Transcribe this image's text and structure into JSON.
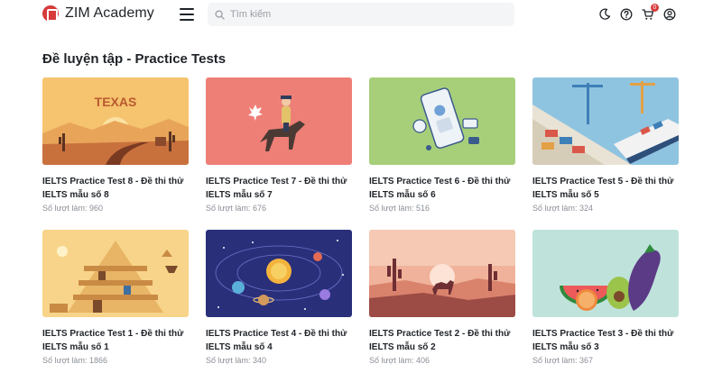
{
  "header": {
    "brand": "ZIM Academy",
    "search_placeholder": "Tìm kiếm",
    "cart_count": "0"
  },
  "main": {
    "title": "Đề luyện tập - Practice Tests",
    "count_label": "Số lượt làm:",
    "tests": [
      {
        "title": "IELTS Practice Test 8 - Đề thi thử IELTS mẫu số 8",
        "count": "960",
        "art": "texas",
        "art_text": "TEXAS"
      },
      {
        "title": "IELTS Practice Test 7 - Đề thi thử IELTS mẫu số 7",
        "count": "676",
        "art": "rider"
      },
      {
        "title": "IELTS Practice Test 6 - Đề thi thử IELTS mẫu số 6",
        "count": "516",
        "art": "phone"
      },
      {
        "title": "IELTS Practice Test 5 - Đề thi thử IELTS mẫu số 5",
        "count": "324",
        "art": "port"
      },
      {
        "title": "IELTS Practice Test 1 - Đề thi thử IELTS mẫu số 1",
        "count": "1866",
        "art": "egypt"
      },
      {
        "title": "IELTS Practice Test 4 - Đề thi thử IELTS mẫu số 4",
        "count": "340",
        "art": "space"
      },
      {
        "title": "IELTS Practice Test 2 - Đề thi thử IELTS mẫu số 2",
        "count": "406",
        "art": "desert"
      },
      {
        "title": "IELTS Practice Test 3 - Đề thi thử IELTS mẫu số 3",
        "count": "367",
        "art": "fruit"
      }
    ]
  },
  "colors": {
    "brand": "#d63a3a",
    "texas": "#f6c36f",
    "rider": "#ee7f77",
    "phone": "#a7cf7a",
    "port": "#8fc4e0",
    "egypt": "#f7d489",
    "space": "#2a2f7a",
    "desert": "#d9826c",
    "fruit": "#bfe3db"
  }
}
